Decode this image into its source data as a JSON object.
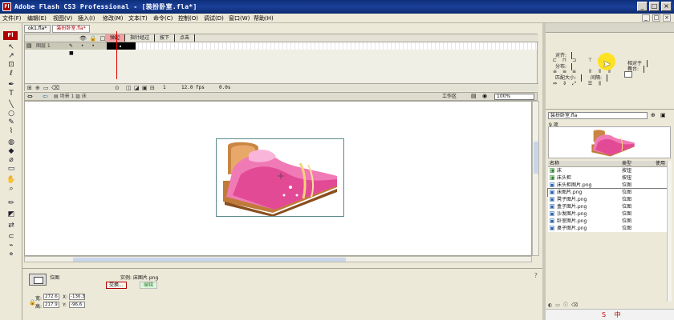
{
  "window": {
    "app_icon_text": "Fl",
    "title": "Adobe Flash CS3 Professional - [装扮卧室.fla*]",
    "buttons": [
      "_",
      "□",
      "×"
    ]
  },
  "menu": {
    "items": [
      "文件(F)",
      "编辑(E)",
      "视图(V)",
      "插入(I)",
      "修改(M)",
      "文本(T)",
      "命令(C)",
      "控制(O)",
      "调试(D)",
      "窗口(W)",
      "帮助(H)"
    ],
    "right_buttons": [
      "_",
      "□",
      "×"
    ]
  },
  "toolbox": {
    "badge": "Fl",
    "tools": [
      "selection-tool",
      "subselection-tool",
      "free-transform-tool",
      "lasso-tool",
      "pen-tool",
      "text-tool",
      "line-tool",
      "oval-tool",
      "pencil-tool",
      "brush-tool",
      "ink-bottle-tool",
      "paint-bucket-tool",
      "eyedropper-tool",
      "eraser-tool",
      "hand-tool",
      "zoom-tool",
      "stroke-color",
      "fill-color",
      "swap-colors",
      "snap-option"
    ]
  },
  "document_tabs": [
    {
      "label": "ok1.fla*",
      "active": false
    },
    {
      "label": "装扮卧室.fla*",
      "active": true
    }
  ],
  "timeline": {
    "frame_labels": [
      "弹起",
      "指针经过",
      "按下",
      "点击"
    ],
    "layer_name": "图层 1",
    "current_frame": "1",
    "fps": "12.0 fps",
    "elapsed": "0.0s"
  },
  "edit_bar": {
    "scene": "场景 1",
    "symbol": "床",
    "workspace": "工作区",
    "zoom": "100%"
  },
  "properties": {
    "type": "位图",
    "instance_label": "实例: 床图片.png",
    "swap_button": "交换...",
    "edit_button": "编辑",
    "w_label": "宽:",
    "w_value": "272.6",
    "h_label": "高:",
    "h_value": "217.9",
    "x_label": "X:",
    "x_value": "-136.3",
    "y_label": "Y:",
    "y_value": "-96.6"
  },
  "align_panel": {
    "align_label": "对齐:",
    "distribute_label": "分布:",
    "match_size_label": "匹配大小:",
    "spacing_label": "间隔:",
    "relative_label": "相对于",
    "stage_label": "舞台:"
  },
  "library": {
    "document": "装扮卧室.fla",
    "count": "9 项",
    "columns": {
      "name": "名称",
      "type": "类型",
      "use": "使用"
    },
    "items": [
      {
        "name": "床",
        "type": "按钮",
        "icon": "button-symbol"
      },
      {
        "name": "床头柜",
        "type": "按钮",
        "icon": "button-symbol"
      },
      {
        "name": "床头柜图片.png",
        "type": "位图",
        "icon": "bitmap"
      },
      {
        "name": "床图片.png",
        "type": "位图",
        "icon": "bitmap",
        "selected": true
      },
      {
        "name": "凳子图片.png",
        "type": "位图",
        "icon": "bitmap"
      },
      {
        "name": "盒子图片.png",
        "type": "位图",
        "icon": "bitmap"
      },
      {
        "name": "沙发图片.png",
        "type": "位图",
        "icon": "bitmap"
      },
      {
        "name": "卧室图片.png",
        "type": "位图",
        "icon": "bitmap"
      },
      {
        "name": "桌子图片.png",
        "type": "位图",
        "icon": "bitmap"
      }
    ]
  },
  "taskbar": {
    "ime": "S 中"
  }
}
